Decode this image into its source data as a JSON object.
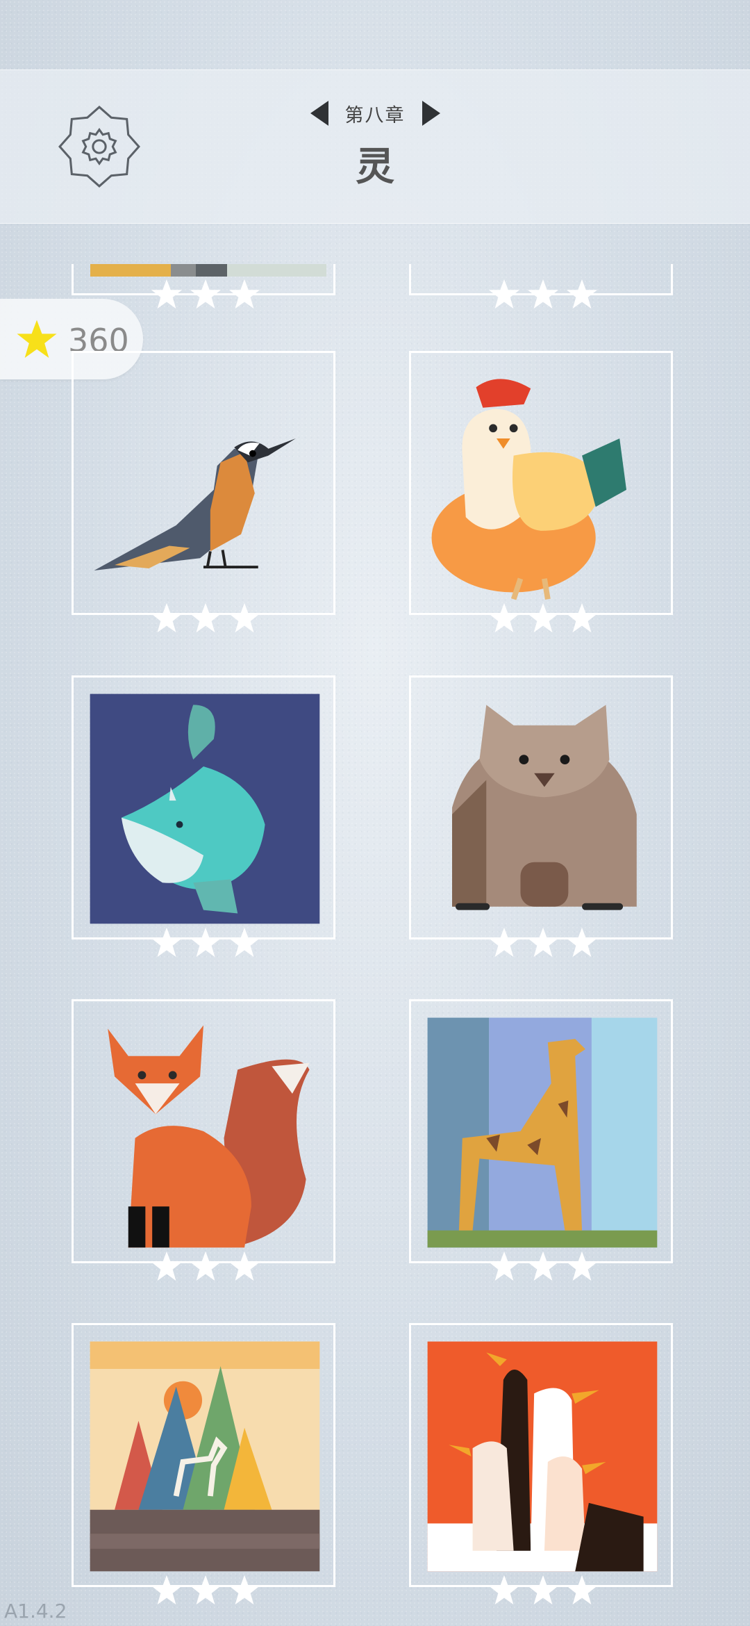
{
  "header": {
    "chapter_label": "第八章",
    "chapter_title": "灵",
    "prev_icon": "triangle-left-icon",
    "next_icon": "triangle-right-icon",
    "settings_icon": "gear-icon"
  },
  "score": {
    "icon": "star-icon",
    "value": "360",
    "star_color": "#f7e01a"
  },
  "levels": [
    {
      "name": "partial-top-left",
      "stars_earned": 0
    },
    {
      "name": "partial-top-right",
      "stars_earned": 0
    },
    {
      "name": "bird",
      "stars_earned": 0
    },
    {
      "name": "chicken",
      "stars_earned": 0
    },
    {
      "name": "whale",
      "stars_earned": 0
    },
    {
      "name": "wombat",
      "stars_earned": 0
    },
    {
      "name": "fox",
      "stars_earned": 0
    },
    {
      "name": "giraffe",
      "stars_earned": 0
    },
    {
      "name": "deer-mountains",
      "stars_earned": 0
    },
    {
      "name": "geese",
      "stars_earned": 0
    }
  ],
  "version": "A1.4.2"
}
